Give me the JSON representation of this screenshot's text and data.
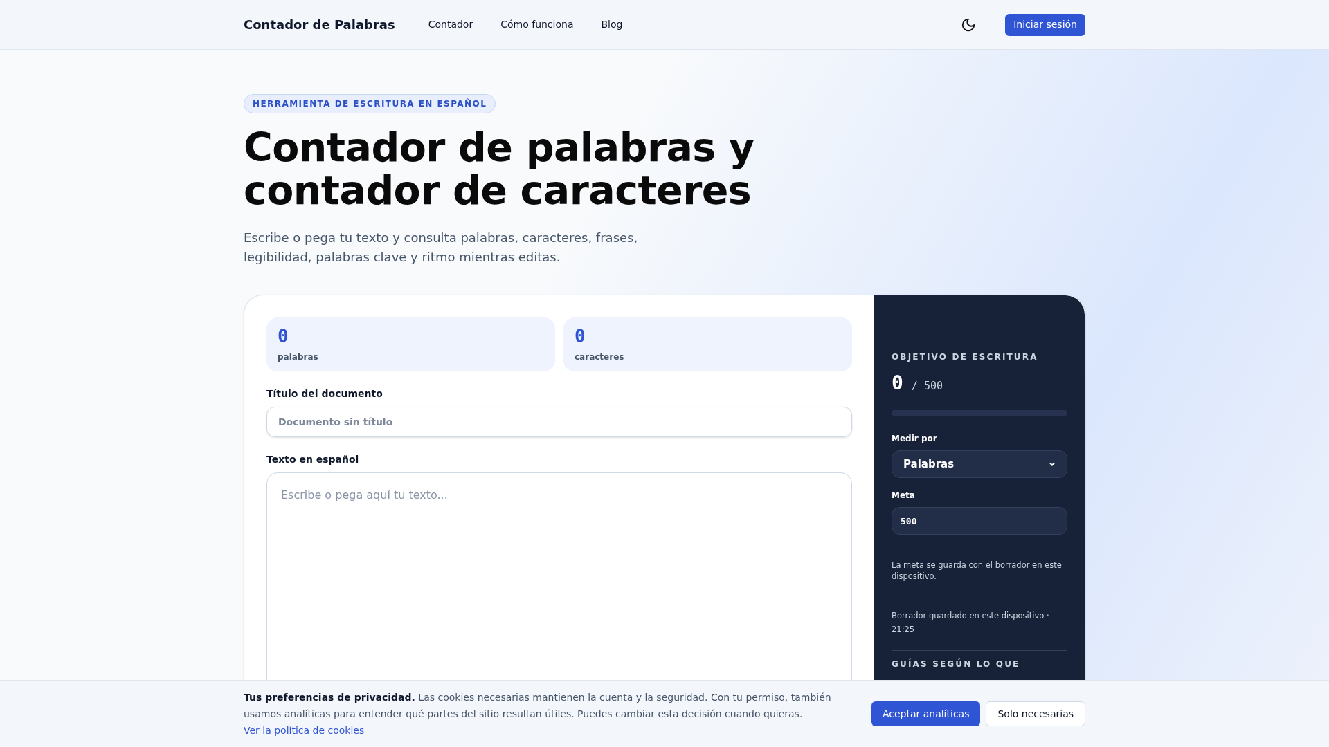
{
  "header": {
    "logo": "Contador de Palabras",
    "nav": [
      {
        "label": "Contador"
      },
      {
        "label": "Cómo funciona"
      },
      {
        "label": "Blog"
      }
    ],
    "login": "Iniciar sesión"
  },
  "hero": {
    "badge": "HERRAMIENTA DE ESCRITURA EN ESPAÑOL",
    "title_lines": [
      "Contador de palabras y",
      "contador de caracteres"
    ],
    "subtitle": "Escribe o pega tu texto y consulta palabras, caracteres, frases, legibilidad, palabras clave y ritmo mientras editas."
  },
  "stats": [
    {
      "value": "0",
      "label": "palabras"
    },
    {
      "value": "0",
      "label": "caracteres"
    }
  ],
  "title_field": {
    "label": "Título del documento",
    "placeholder": "Documento sin título"
  },
  "text_field": {
    "label": "Texto en español",
    "placeholder": "Escribe o pega aquí tu texto..."
  },
  "goal": {
    "heading": "OBJETIVO DE ESCRITURA",
    "current": "0",
    "target": "/ 500",
    "level": 0,
    "measure_label": "Medir por",
    "measure_value": "Palabras",
    "meta_label": "Meta",
    "meta_value": "500",
    "note": "La meta se guarda con el borrador en este dispositivo.",
    "saved": "Borrador guardado en este dispositivo · 21:25",
    "guides_heading": "GUÍAS SEGÚN LO QUE"
  },
  "cookies": {
    "lead": "Tus preferencias de privacidad.",
    "text": "Las cookies necesarias mantienen la cuenta y la seguridad. Con tu permiso, también usamos analíticas para entender qué partes del sitio resultan útiles. Puedes cambiar esta decisión cuando quieras.",
    "link": "Ver la política de cookies",
    "accept": "Aceptar analíticas",
    "reject": "Solo necesarias"
  }
}
